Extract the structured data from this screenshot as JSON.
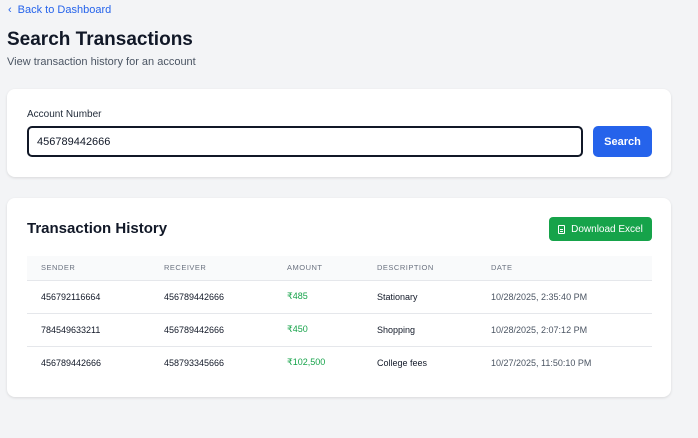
{
  "nav": {
    "back_label": "Back to Dashboard",
    "back_icon": "chevron-left-icon"
  },
  "header": {
    "title": "Search Transactions",
    "subtitle": "View transaction history for an account"
  },
  "search": {
    "label": "Account Number",
    "value": "456789442666",
    "button_label": "Search"
  },
  "history": {
    "title": "Transaction History",
    "download_label": "Download Excel",
    "columns": [
      "SENDER",
      "RECEIVER",
      "AMOUNT",
      "DESCRIPTION",
      "DATE"
    ],
    "rows": [
      {
        "sender": "456792116664",
        "receiver": "456789442666",
        "amount": "₹485",
        "description": "Stationary",
        "date": "10/28/2025, 2:35:40 PM"
      },
      {
        "sender": "784549633211",
        "receiver": "456789442666",
        "amount": "₹450",
        "description": "Shopping",
        "date": "10/28/2025, 2:07:12 PM"
      },
      {
        "sender": "456789442666",
        "receiver": "458793345666",
        "amount": "₹102,500",
        "description": "College fees",
        "date": "10/27/2025, 11:50:10 PM"
      }
    ]
  },
  "colors": {
    "accent": "#2563eb",
    "success": "#16a34a",
    "background": "#f3f4f6"
  }
}
